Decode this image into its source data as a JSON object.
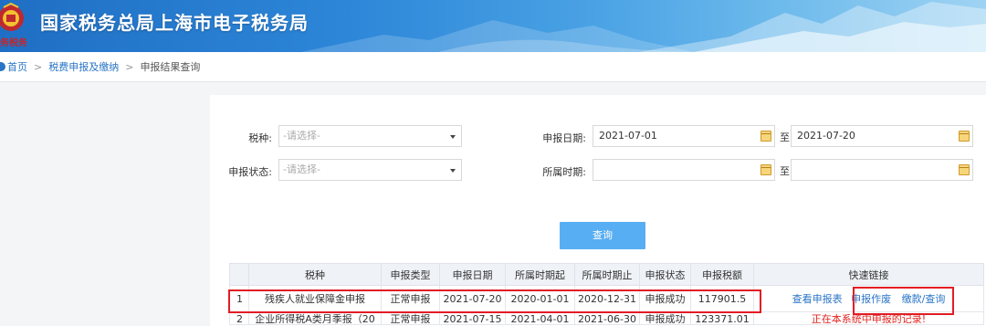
{
  "header": {
    "title": "国家税务总局上海市电子税务局",
    "seal_text": "务税务",
    "emblem_icon": "tax-emblem-icon",
    "colors": {
      "banner_dark": "#1f6fc4",
      "banner_light": "#9fd3f3"
    }
  },
  "breadcrumb": {
    "home_icon": "home-icon",
    "home": "首页",
    "level2": "税费申报及缴纳",
    "current": "申报结果查询",
    "separator": ">"
  },
  "filters": {
    "tax_type": {
      "label": "税种:",
      "placeholder": "-请选择-"
    },
    "status": {
      "label": "申报状态:",
      "placeholder": "-请选择-"
    },
    "declare_date": {
      "label": "申报日期:",
      "from": "2021-07-01",
      "to_label": "至",
      "to": "2021-07-20"
    },
    "period": {
      "label": "所属时期:",
      "from": "",
      "to_label": "至",
      "to": ""
    },
    "calendar_icon": "calendar-icon",
    "query_button": "查询"
  },
  "table": {
    "headers": [
      "",
      "税种",
      "申报类型",
      "申报日期",
      "所属时期起",
      "所属时期止",
      "申报状态",
      "申报税额",
      "快速链接"
    ],
    "rows": [
      {
        "index": "1",
        "tax": "残疾人就业保障金申报",
        "type": "正常申报",
        "date": "2021-07-20",
        "period_start": "2020-01-01",
        "period_end": "2020-12-31",
        "status": "申报成功",
        "amount": "117901.5",
        "links": {
          "view": "查看申报表",
          "void": "申报作废",
          "pay": "缴款/查询"
        }
      },
      {
        "index": "2",
        "tax": "企业所得税A类月季报（20",
        "type": "正常申报",
        "date": "2021-07-15",
        "period_start": "2021-04-01",
        "period_end": "2021-06-30",
        "status": "申报成功",
        "amount": "123371.01",
        "note": "正在本系统中申报的记录!"
      }
    ]
  },
  "colors": {
    "accent": "#2a74c6",
    "button": "#58aef2",
    "highlight": "#e21d25",
    "warn": "#e0241d"
  }
}
